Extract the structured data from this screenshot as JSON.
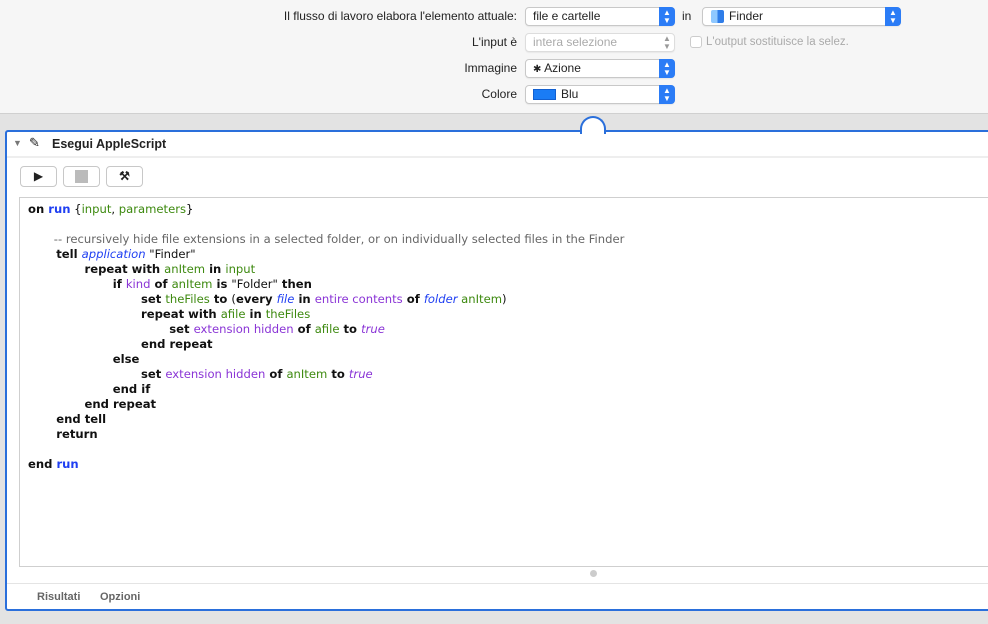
{
  "header": {
    "workflow_label": "Il flusso di lavoro elabora l'elemento attuale:",
    "workflow_value": "file e cartelle",
    "in_label": "in",
    "app_value": "Finder",
    "input_label": "L'input è",
    "input_value": "intera selezione",
    "output_checkbox": "L'output sostituisce la selez.",
    "output_checked": false,
    "image_label": "Immagine",
    "image_value": "Azione",
    "color_label": "Colore",
    "color_value": "Blu",
    "color_swatch": "#1a7cf5"
  },
  "action": {
    "title": "Esegui AppleScript",
    "tabs": [
      "Risultati",
      "Opzioni"
    ],
    "code": [
      [
        [
          "on ",
          "k"
        ],
        [
          "run",
          "b"
        ],
        [
          " {",
          "s"
        ],
        [
          "input",
          "v"
        ],
        [
          ", ",
          "s"
        ],
        [
          "parameters",
          "v"
        ],
        [
          "}",
          "s"
        ]
      ],
      [],
      [
        [
          "\t-- recursively hide file extensions in a selected folder, or on individually selected files in the Finder",
          "c"
        ]
      ],
      [
        [
          "\ttell ",
          "k"
        ],
        [
          "application",
          "a"
        ],
        [
          " \"Finder\"",
          "s"
        ]
      ],
      [
        [
          "\t\trepeat with ",
          "k"
        ],
        [
          "anItem",
          "v"
        ],
        [
          " in ",
          "k"
        ],
        [
          "input",
          "v"
        ]
      ],
      [
        [
          "\t\t\tif ",
          "k"
        ],
        [
          "kind",
          "p"
        ],
        [
          " of ",
          "k"
        ],
        [
          "anItem",
          "v"
        ],
        [
          " is ",
          "k"
        ],
        [
          "\"Folder\"",
          "s"
        ],
        [
          " then",
          "k"
        ]
      ],
      [
        [
          "\t\t\t\tset ",
          "k"
        ],
        [
          "theFiles",
          "v"
        ],
        [
          " to ",
          "k"
        ],
        [
          "(",
          "s"
        ],
        [
          "every ",
          "k"
        ],
        [
          "file",
          "a"
        ],
        [
          " in ",
          "k"
        ],
        [
          "entire contents",
          "p"
        ],
        [
          " of ",
          "k"
        ],
        [
          "folder",
          "a"
        ],
        [
          " ",
          "s"
        ],
        [
          "anItem",
          "v"
        ],
        [
          ")",
          "s"
        ]
      ],
      [
        [
          "\t\t\t\trepeat with ",
          "k"
        ],
        [
          "afile",
          "v"
        ],
        [
          " in ",
          "k"
        ],
        [
          "theFiles",
          "v"
        ]
      ],
      [
        [
          "\t\t\t\t\tset ",
          "k"
        ],
        [
          "extension hidden",
          "p"
        ],
        [
          " of ",
          "k"
        ],
        [
          "afile",
          "v"
        ],
        [
          " to ",
          "k"
        ],
        [
          "true",
          "t"
        ]
      ],
      [
        [
          "\t\t\t\tend repeat",
          "k"
        ]
      ],
      [
        [
          "\t\t\telse",
          "k"
        ]
      ],
      [
        [
          "\t\t\t\tset ",
          "k"
        ],
        [
          "extension hidden",
          "p"
        ],
        [
          " of ",
          "k"
        ],
        [
          "anItem",
          "v"
        ],
        [
          " to ",
          "k"
        ],
        [
          "true",
          "t"
        ]
      ],
      [
        [
          "\t\t\tend if",
          "k"
        ]
      ],
      [
        [
          "\t\tend repeat",
          "k"
        ]
      ],
      [
        [
          "\tend tell",
          "k"
        ]
      ],
      [
        [
          "\treturn",
          "k"
        ]
      ],
      [],
      [
        [
          "end ",
          "k"
        ],
        [
          "run",
          "b"
        ]
      ]
    ]
  }
}
